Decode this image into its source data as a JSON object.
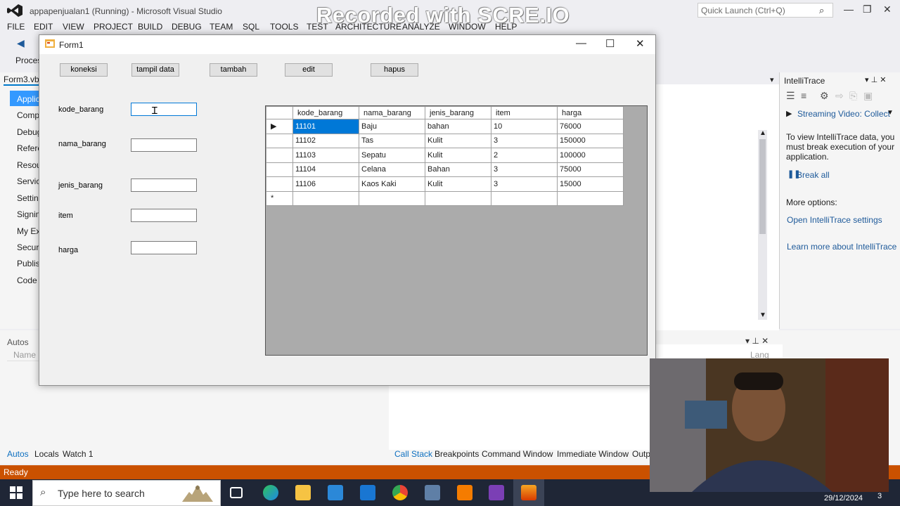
{
  "vs": {
    "title": "appapenjualan1 (Running) - Microsoft Visual Studio",
    "watermark": "Recorded with SCRE.IO",
    "quick_launch_placeholder": "Quick Launch (Ctrl+Q)",
    "menu": [
      "FILE",
      "EDIT",
      "VIEW",
      "PROJECT",
      "BUILD",
      "DEBUG",
      "TEAM",
      "SQL",
      "TOOLS",
      "TEST",
      "ARCHITECTURE",
      "ANALYZE",
      "WINDOW",
      "HELP"
    ],
    "toolbar_process_label": "Proces",
    "left_tab": "Form3.vb",
    "left_items": [
      "Applic",
      "Comp",
      "Debug",
      "Refere",
      "Resou",
      "Servic",
      "Setting",
      "Signin",
      "My Ext",
      "Securi",
      "Publis",
      "Code A"
    ],
    "intellitrace": {
      "title": "IntelliTrace",
      "streaming": "Streaming Video: Collect",
      "description": "To view IntelliTrace data, you must break execution of your application.",
      "break_all": "Break all",
      "more_options": "More options:",
      "open_settings": "Open IntelliTrace settings",
      "learn_more": "Learn more about IntelliTrace"
    },
    "autos": {
      "title": "Autos",
      "name_col": "Name",
      "lang_col": "Lang"
    },
    "bottom_tabs_left": [
      "Autos",
      "Locals",
      "Watch 1"
    ],
    "bottom_tabs_right": [
      "Call Stack",
      "Breakpoints",
      "Command Window",
      "Immediate Window",
      "Outp"
    ],
    "status": "Ready"
  },
  "taskbar": {
    "search_placeholder": "Type here to search",
    "date": "29/12/2024",
    "notifications": "3"
  },
  "form1": {
    "title": "Form1",
    "buttons": {
      "koneksi": "koneksi",
      "tampil": "tampil data",
      "tambah": "tambah",
      "edit": "edit",
      "hapus": "hapus"
    },
    "labels": {
      "kode": "kode_barang",
      "nama": "nama_barang",
      "jenis": "jenis_barang",
      "item": "item",
      "harga": "harga"
    },
    "grid": {
      "columns": [
        "kode_barang",
        "nama_barang",
        "jenis_barang",
        "item",
        "harga"
      ],
      "rows": [
        [
          "11101",
          "Baju",
          "bahan",
          "10",
          "76000"
        ],
        [
          "11102",
          "Tas",
          "Kulit",
          "3",
          "150000"
        ],
        [
          "11103",
          "Sepatu",
          "Kulit",
          "2",
          "100000"
        ],
        [
          "11104",
          "Celana",
          "Bahan",
          "3",
          "75000"
        ],
        [
          "11106",
          "Kaos Kaki",
          "Kulit",
          "3",
          "15000"
        ]
      ],
      "new_row_marker": "*",
      "current_row_marker": "▶"
    }
  }
}
